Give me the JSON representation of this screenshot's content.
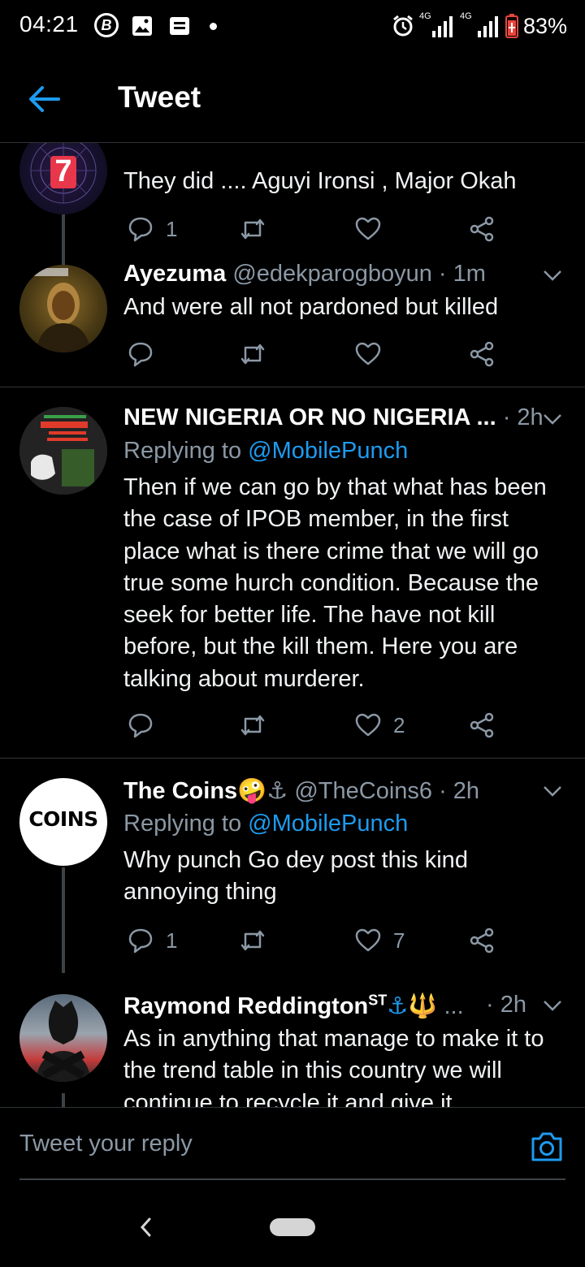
{
  "status_bar": {
    "time": "04:21",
    "network_1": "4G",
    "network_2": "4G",
    "battery": "83%",
    "battery_color": "#e8453c"
  },
  "header": {
    "title": "Tweet"
  },
  "tweets": [
    {
      "avatar_text": "7",
      "text": "They did .... Aguyi Ironsi , Major Okah",
      "reply_count": "1",
      "retweet_count": "",
      "like_count": ""
    },
    {
      "name": "Ayezuma",
      "handle": "@edekparogboyun",
      "time": "· 1m",
      "text": "And were all not pardoned but killed",
      "reply_count": "",
      "retweet_count": "",
      "like_count": ""
    },
    {
      "name": "NEW NIGERIA OR NO NIGERIA ...",
      "time": "· 2h",
      "replying_prefix": "Replying to ",
      "replying_to": "@MobilePunch",
      "text": "Then if we can go by that what has been the case of IPOB member, in the first place what is there crime that we will go true some hurch condition. Because the seek for better life. The have not kill before, but the kill them. Here you are talking about murderer.",
      "reply_count": "",
      "retweet_count": "",
      "like_count": "2"
    },
    {
      "name": "The Coins",
      "name_emoji": "🤪⚓",
      "handle": "@TheCoins6",
      "time": "· 2h",
      "avatar_text": "COINS",
      "replying_prefix": "Replying to ",
      "replying_to": "@MobilePunch",
      "text": "Why punch Go dey post this kind annoying thing",
      "reply_count": "1",
      "retweet_count": "",
      "like_count": "7"
    },
    {
      "name": "Raymond Reddington",
      "name_suffix": "ST",
      "name_emoji": "⚓🔱",
      "ellipsis": "...",
      "time": "· 2h",
      "text": "As in anything that manage to make it to the trend table in this country we will continue to recycle it and give it"
    }
  ],
  "reply_bar": {
    "placeholder": "Tweet your reply"
  },
  "colors": {
    "background": "#000000",
    "accent": "#1d9bf0",
    "muted": "#8b98a5",
    "divider": "#2f3336"
  }
}
